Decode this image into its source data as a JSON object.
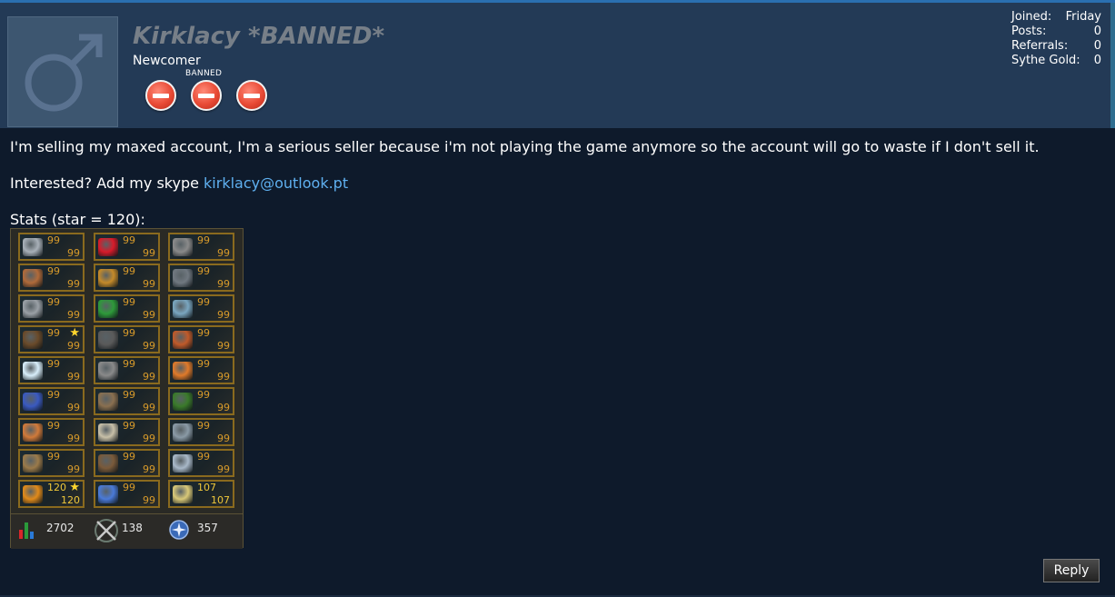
{
  "user": {
    "name": "Kirklacy *BANNED*",
    "title": "Newcomer",
    "banned_label": "BANNED",
    "badge_icon": "no-entry-icon",
    "avatar_icon": "male-symbol-icon"
  },
  "stats": [
    {
      "label": "Joined:",
      "value": "Friday"
    },
    {
      "label": "Posts:",
      "value": "0"
    },
    {
      "label": "Referrals:",
      "value": "0"
    },
    {
      "label": "Sythe Gold:",
      "value": "0"
    }
  ],
  "post": {
    "paragraph1": "I'm selling my maxed account, I'm a serious seller because i'm not playing the game anymore so the account will go to waste if I don't sell it.",
    "paragraph2_prefix": "Interested? Add my skype ",
    "skype_link": "kirklacy@outlook.pt",
    "paragraph3": "Stats (star = 120):"
  },
  "skills": [
    {
      "icon": "attack-sword-icon",
      "level": "99",
      "color": "#a8b0b8"
    },
    {
      "icon": "constitution-heart-icon",
      "level": "99",
      "color": "#d81b2a"
    },
    {
      "icon": "mining-pickaxe-icon",
      "level": "99",
      "color": "#8a8a8a"
    },
    {
      "icon": "strength-fist-icon",
      "level": "99",
      "color": "#b06a3a"
    },
    {
      "icon": "agility-runner-icon",
      "level": "99",
      "color": "#c48a2a"
    },
    {
      "icon": "smithing-anvil-icon",
      "level": "99",
      "color": "#707880"
    },
    {
      "icon": "defence-shield-icon",
      "level": "99",
      "color": "#9aa0a6"
    },
    {
      "icon": "herblore-leaf-icon",
      "level": "99",
      "color": "#2e9a3a"
    },
    {
      "icon": "fishing-fish-icon",
      "level": "99",
      "color": "#7aa6c0"
    },
    {
      "icon": "ranged-bow-icon",
      "level": "99",
      "color": "#6a4a2a",
      "star": true
    },
    {
      "icon": "thieving-mask-icon",
      "level": "99",
      "color": "#5a5a5a"
    },
    {
      "icon": "cooking-pot-icon",
      "level": "99",
      "color": "#c05a2a"
    },
    {
      "icon": "prayer-star-icon",
      "level": "99",
      "color": "#d8eefa"
    },
    {
      "icon": "crafting-tools-icon",
      "level": "99",
      "color": "#8a8a8a"
    },
    {
      "icon": "firemaking-fire-icon",
      "level": "99",
      "color": "#e07a2a"
    },
    {
      "icon": "magic-hat-icon",
      "level": "99",
      "color": "#3a5ac0"
    },
    {
      "icon": "fletching-arrow-icon",
      "level": "99",
      "color": "#8a7050"
    },
    {
      "icon": "woodcutting-tree-icon",
      "level": "99",
      "color": "#3a7a2a"
    },
    {
      "icon": "runecrafting-rune-icon",
      "level": "99",
      "color": "#d07a3a"
    },
    {
      "icon": "slayer-skull-icon",
      "level": "99",
      "color": "#c8c0a8"
    },
    {
      "icon": "farming-can-icon",
      "level": "99",
      "color": "#8a9aa6"
    },
    {
      "icon": "construction-hammer-icon",
      "level": "99",
      "color": "#9a7a4a"
    },
    {
      "icon": "hunter-paw-icon",
      "level": "99",
      "color": "#7a5a3a"
    },
    {
      "icon": "summoning-pouch-icon",
      "level": "99",
      "color": "#a8b8c8"
    },
    {
      "icon": "dungeoneering-door-icon",
      "level": "120",
      "color": "#e08a1a",
      "star": true,
      "gold": true
    },
    {
      "icon": "divination-orb-icon",
      "level": "99",
      "color": "#4a7ad8"
    },
    {
      "icon": "invention-bulb-icon",
      "level": "107",
      "color": "#d8c878",
      "gold": true
    }
  ],
  "footer": {
    "total_level": "2702",
    "combat_level": "138",
    "quest_points": "357",
    "total_icon": "bar-chart-icon",
    "combat_icon": "crossed-swords-icon",
    "quest_icon": "quest-compass-icon"
  },
  "reply_label": "Reply"
}
